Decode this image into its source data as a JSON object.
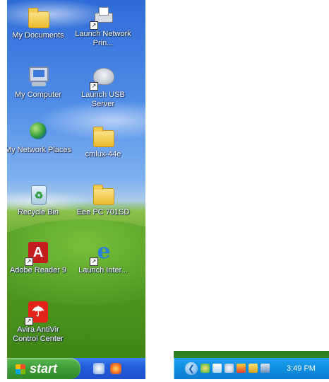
{
  "desktop": {
    "icons": [
      {
        "label": "My Documents",
        "icon": "folder-documents-icon",
        "shortcut": false
      },
      {
        "label": "Launch Network Prin...",
        "icon": "network-printer-icon",
        "shortcut": true
      },
      {
        "label": "My Computer",
        "icon": "computer-icon",
        "shortcut": false
      },
      {
        "label": "Launch USB Server",
        "icon": "usb-server-icon",
        "shortcut": true
      },
      {
        "label": "My Network Places",
        "icon": "network-globe-icon",
        "shortcut": false
      },
      {
        "label": "cmlux-44e",
        "icon": "folder-icon",
        "shortcut": false
      },
      {
        "label": "Recycle Bin",
        "icon": "recycle-bin-icon",
        "shortcut": false
      },
      {
        "label": "Eee PC 701SD",
        "icon": "folder-icon",
        "shortcut": false
      },
      {
        "label": "Adobe Reader 9",
        "icon": "pdf-icon",
        "shortcut": true
      },
      {
        "label": "Launch Inter...",
        "icon": "internet-explorer-icon",
        "shortcut": true
      },
      {
        "label": "Avira AntiVir Control Center",
        "icon": "avira-umbrella-icon",
        "shortcut": true
      }
    ]
  },
  "taskbar": {
    "start_label": "start",
    "quick_launch": [
      "quick-launch-icon-1",
      "quick-launch-icon-2"
    ]
  },
  "tray": {
    "time": "3:49 PM",
    "icons": [
      "show-hidden-icons",
      "network-icon",
      "security-icon",
      "cloud-icon",
      "alert-icon",
      "device-icon",
      "display-icon"
    ]
  },
  "colors": {
    "taskbar_blue": "#245edc",
    "start_green": "#3c9a36",
    "tray_blue": "#0f8ddf"
  }
}
